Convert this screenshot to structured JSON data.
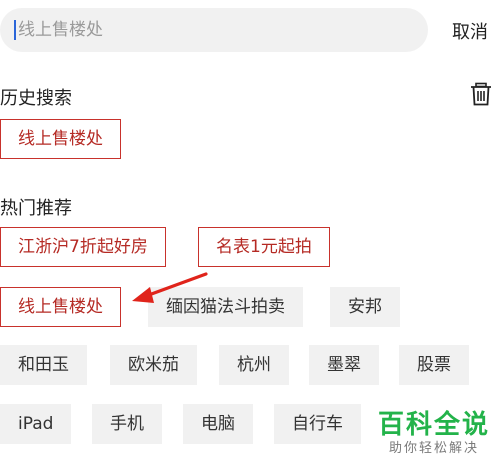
{
  "search": {
    "placeholder": "线上售楼处",
    "cancel_label": "取消"
  },
  "history": {
    "title": "历史搜索",
    "items": [
      "线上售楼处"
    ]
  },
  "hot": {
    "title": "热门推荐",
    "row1": [
      "江浙沪7折起好房",
      "名表1元起拍"
    ],
    "row2": [
      "线上售楼处",
      "缅因猫法斗拍卖",
      "安邦"
    ],
    "row3": [
      "和田玉",
      "欧米茄",
      "杭州",
      "墨翠",
      "股票"
    ],
    "row4": [
      "iPad",
      "手机",
      "电脑",
      "自行车"
    ]
  },
  "watermark": {
    "main": "百科全说",
    "sub": "助你轻松解决"
  },
  "colors": {
    "accent_red": "#c8322c",
    "tag_gray": "#f1f1f1",
    "watermark_green": "#23b34a"
  }
}
